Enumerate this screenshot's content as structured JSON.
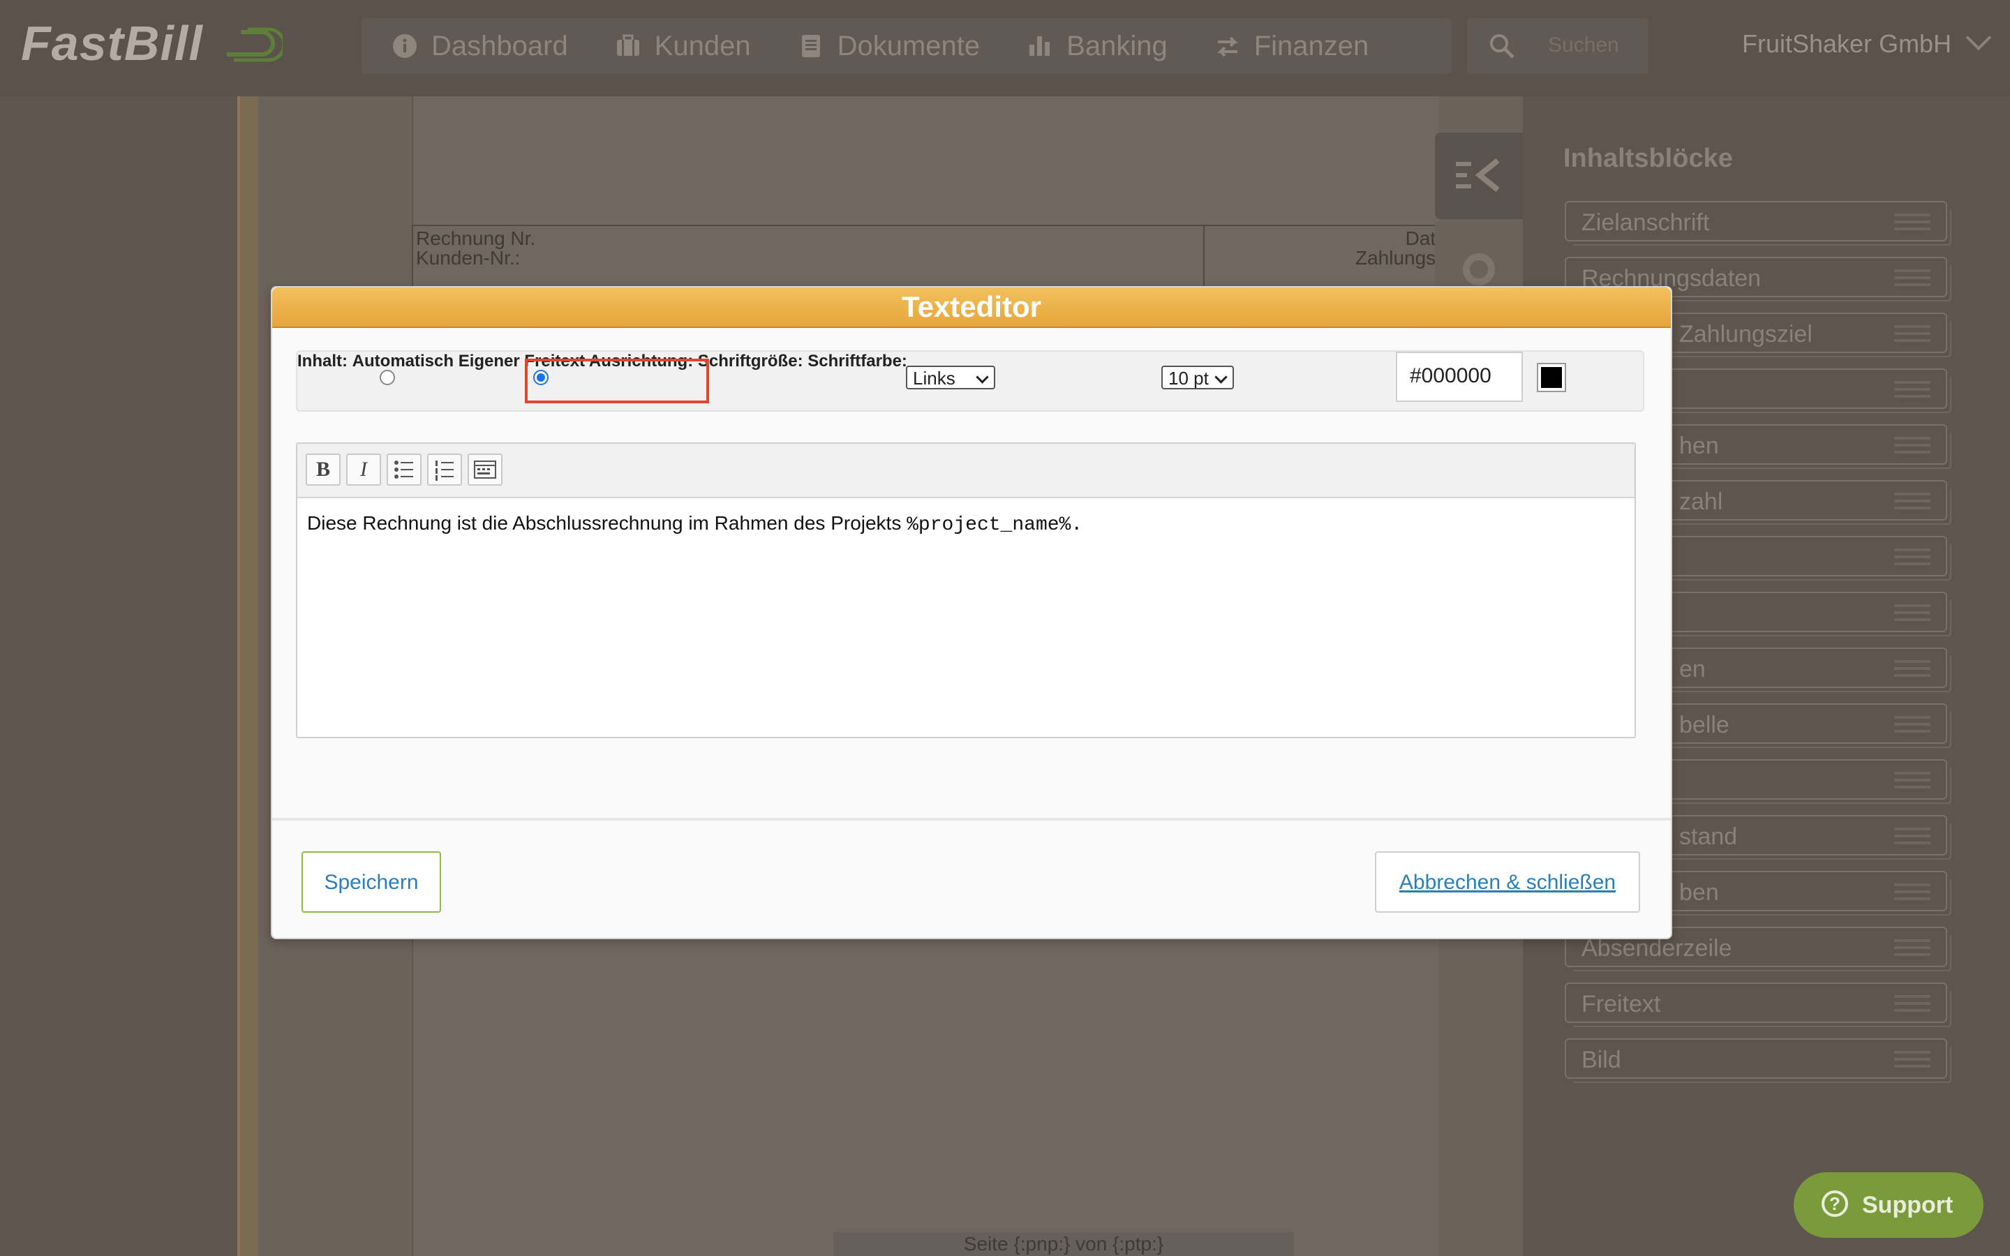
{
  "app": {
    "logo": "FastBill"
  },
  "nav": {
    "items": [
      {
        "label": "Dashboard",
        "icon": "info-icon"
      },
      {
        "label": "Kunden",
        "icon": "briefcase-icon"
      },
      {
        "label": "Dokumente",
        "icon": "document-icon"
      },
      {
        "label": "Banking",
        "icon": "bar-chart-icon"
      },
      {
        "label": "Finanzen",
        "icon": "transfer-arrows-icon"
      }
    ],
    "search_placeholder": "Suchen",
    "company": "FruitShaker GmbH"
  },
  "document": {
    "header_left_line1": "Rechnung Nr.",
    "header_left_line2": "Kunden-Nr.:",
    "header_right_line1": "Dat",
    "header_right_line2": "Zahlungs",
    "footer": "Seite {:pnp:} von {:ptp:}"
  },
  "sidebar": {
    "title": "Inhaltsblöcke",
    "blocks": [
      "Zielanschrift",
      "Rechnungsdaten",
      "Zahlungsziel",
      "",
      "hen",
      "zahl",
      "",
      "",
      "en",
      "belle",
      "",
      "stand",
      "ben",
      "Absenderzeile",
      "Freitext",
      "Bild"
    ]
  },
  "support": {
    "label": "Support"
  },
  "modal": {
    "title": "Texteditor",
    "options": {
      "content_label": "Inhalt:",
      "radio_auto": "Automatisch",
      "radio_custom": "Eigener Freitext",
      "selected": "custom",
      "alignment_label": "Ausrichtung:",
      "alignment_value": "Links",
      "fontsize_label": "Schriftgröße:",
      "fontsize_value": "10 pt",
      "fontcolor_label": "Schriftfarbe:",
      "fontcolor_value": "#000000"
    },
    "toolbar": {
      "bold": "B",
      "italic": "I"
    },
    "editor": {
      "text_plain": "Diese Rechnung ist die Abschlussrechnung im Rahmen des Projekts ",
      "text_placeholder": "%project_name%."
    },
    "buttons": {
      "save": "Speichern",
      "cancel": "Abbrechen & schließen"
    }
  },
  "colors": {
    "accent_orange": "#e5a63a",
    "save_border": "#8dbb4a",
    "link_blue": "#2a7fb8",
    "highlight_red": "#e0472f",
    "support_green": "#7a9a3c"
  }
}
